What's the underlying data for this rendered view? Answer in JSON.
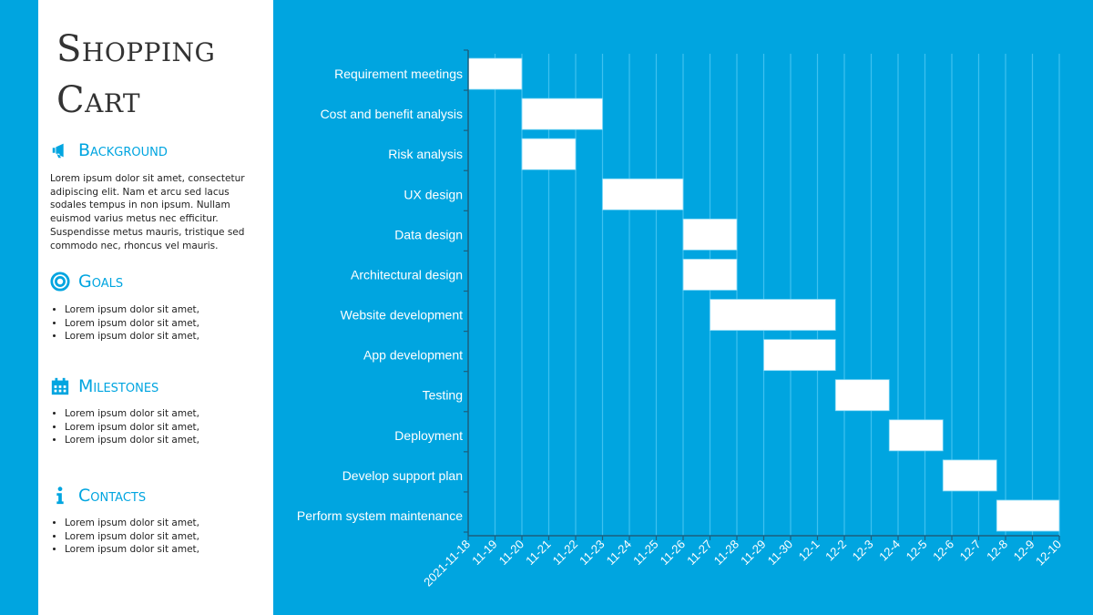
{
  "sidebar": {
    "title_line1": "Shopping",
    "title_line2": "Cart",
    "sections": [
      {
        "icon": "megaphone-icon",
        "heading": "Background",
        "paragraph": "Lorem ipsum dolor sit amet, consectetur adipiscing elit. Nam et arcu sed lacus sodales tempus in non ipsum. Nullam euismod varius metus nec efficitur. Suspendisse metus mauris, tristique sed commodo nec, rhoncus vel mauris."
      },
      {
        "icon": "target-icon",
        "heading": "Goals",
        "items": [
          "Lorem ipsum dolor sit amet,",
          "Lorem ipsum dolor sit amet,",
          "Lorem ipsum dolor sit amet,"
        ]
      },
      {
        "icon": "calendar-icon",
        "heading": "Milestones",
        "items": [
          "Lorem ipsum dolor sit amet,",
          "Lorem ipsum dolor sit amet,",
          "Lorem ipsum dolor sit amet,"
        ]
      },
      {
        "icon": "info-icon",
        "heading": "Contacts",
        "items": [
          "Lorem ipsum dolor sit amet,",
          "Lorem ipsum dolor sit amet,",
          "Lorem ipsum dolor sit amet,"
        ]
      }
    ]
  },
  "colors": {
    "background": "#00a5e0",
    "bar": "#ffffff",
    "accent": "#00a5e0",
    "title_text": "#333333"
  },
  "chart_data": {
    "type": "gantt",
    "title": "",
    "xlabel": "",
    "ylabel": "",
    "x_start": "2021-11-18",
    "x_ticks": [
      "2021-11-18",
      "11-19",
      "11-20",
      "11-21",
      "11-22",
      "11-23",
      "11-24",
      "11-25",
      "11-26",
      "11-27",
      "11-28",
      "11-29",
      "11-30",
      "12-1",
      "12-2",
      "12-3",
      "12-4",
      "12-5",
      "12-6",
      "12-7",
      "12-8",
      "12-9",
      "12-10"
    ],
    "xlim_days": [
      0,
      22
    ],
    "grid": "vertical",
    "legend": "none",
    "tasks": [
      {
        "name": "Requirement meetings",
        "start": "2021-11-18",
        "end": "2021-11-20",
        "start_day": 0,
        "end_day": 2
      },
      {
        "name": "Cost and benefit analysis",
        "start": "2021-11-20",
        "end": "2021-11-23",
        "start_day": 2,
        "end_day": 5
      },
      {
        "name": "Risk analysis",
        "start": "2021-11-20",
        "end": "2021-11-22",
        "start_day": 2,
        "end_day": 4
      },
      {
        "name": "UX design",
        "start": "2021-11-23",
        "end": "2021-11-26",
        "start_day": 5,
        "end_day": 8
      },
      {
        "name": "Data design",
        "start": "2021-11-26",
        "end": "2021-11-28",
        "start_day": 8,
        "end_day": 10
      },
      {
        "name": "Architectural design",
        "start": "2021-11-26",
        "end": "2021-11-28",
        "start_day": 8,
        "end_day": 10
      },
      {
        "name": "Website development",
        "start": "2021-11-27",
        "end": "2021-12-01 16:00",
        "start_day": 9,
        "end_day": 13.67
      },
      {
        "name": "App development",
        "start": "2021-11-29",
        "end": "2021-12-01 16:00",
        "start_day": 11,
        "end_day": 13.67
      },
      {
        "name": "Testing",
        "start": "2021-12-01 16:00",
        "end": "2021-12-03 16:00",
        "start_day": 13.67,
        "end_day": 15.67
      },
      {
        "name": "Deployment",
        "start": "2021-12-03 16:00",
        "end": "2021-12-05 16:00",
        "start_day": 15.67,
        "end_day": 17.67
      },
      {
        "name": "Develop support plan",
        "start": "2021-12-05 16:00",
        "end": "2021-12-07 16:00",
        "start_day": 17.67,
        "end_day": 19.67
      },
      {
        "name": "Perform system maintenance",
        "start": "2021-12-07 16:00",
        "end": "2021-12-10",
        "start_day": 19.67,
        "end_day": 22
      }
    ]
  }
}
